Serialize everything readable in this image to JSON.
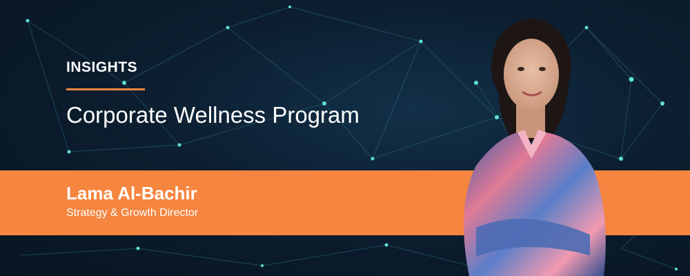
{
  "banner": {
    "eyebrow": "INSIGHTS",
    "title": "Corporate Wellness Program",
    "person_name": "Lama Al-Bachir",
    "person_role": "Strategy & Growth Director"
  },
  "colors": {
    "accent": "#f5853f",
    "background": "#0c1e30",
    "network_node": "#5fe0d6"
  }
}
